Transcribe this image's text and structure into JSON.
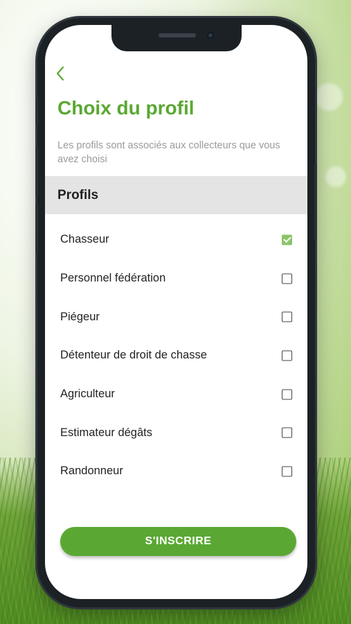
{
  "header": {
    "back_icon": "chevron-left-icon",
    "title": "Choix du profil",
    "subtitle": "Les profils sont associés aux collecteurs que vous avez choisi"
  },
  "section": {
    "title": "Profils"
  },
  "profiles": [
    {
      "label": "Chasseur",
      "checked": true
    },
    {
      "label": "Personnel fédération",
      "checked": false
    },
    {
      "label": "Piégeur",
      "checked": false
    },
    {
      "label": "Détenteur de droit de chasse",
      "checked": false
    },
    {
      "label": "Agriculteur",
      "checked": false
    },
    {
      "label": "Estimateur dégâts",
      "checked": false
    },
    {
      "label": "Randonneur",
      "checked": false
    }
  ],
  "cta": {
    "label": "S'INSCRIRE"
  },
  "colors": {
    "accent": "#5aa833",
    "checked": "#8cc46a",
    "section_bg": "#e4e4e4"
  }
}
